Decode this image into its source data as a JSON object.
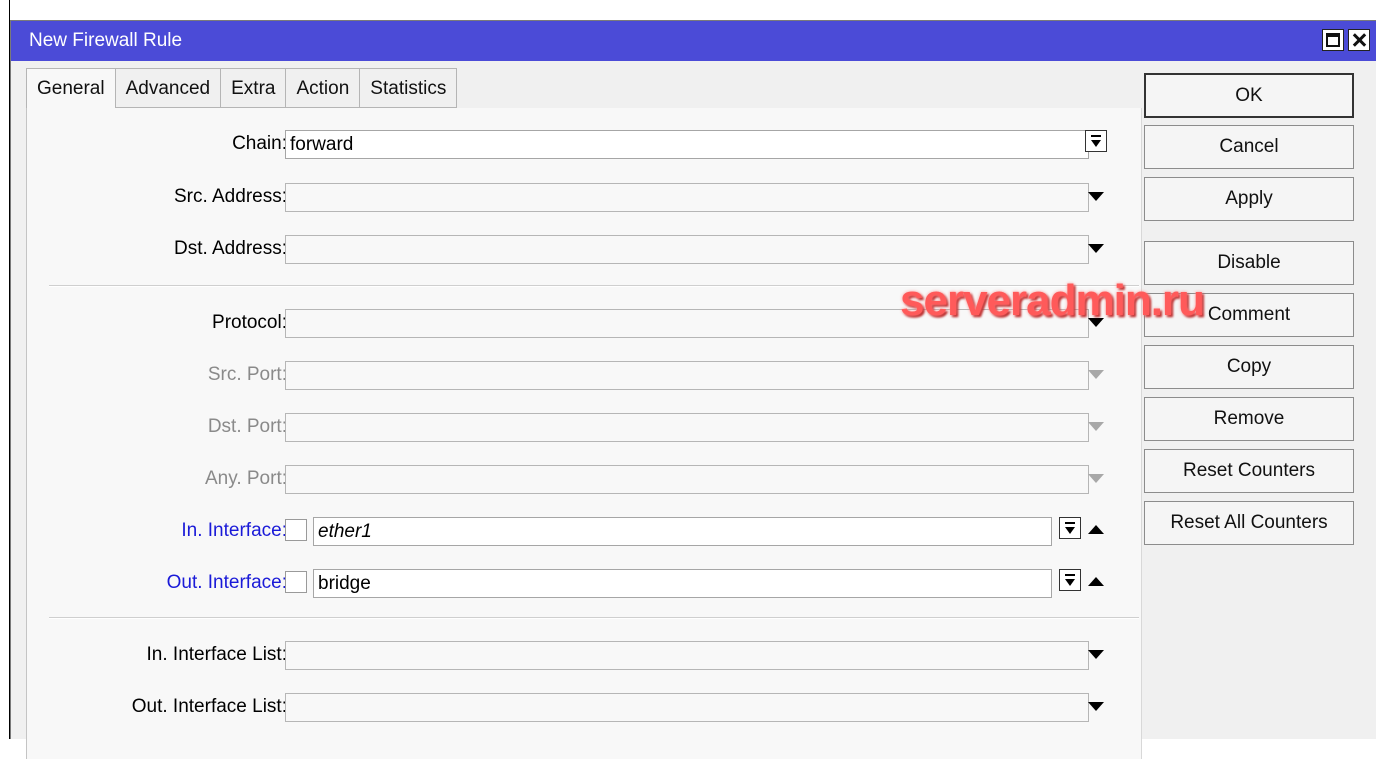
{
  "window": {
    "title": "New Firewall Rule"
  },
  "tabs": [
    "General",
    "Advanced",
    "Extra",
    "Action",
    "Statistics"
  ],
  "form": {
    "chain_label": "Chain:",
    "chain_value": "forward",
    "src_address_label": "Src. Address:",
    "src_address_value": "",
    "dst_address_label": "Dst. Address:",
    "dst_address_value": "",
    "protocol_label": "Protocol:",
    "protocol_value": "",
    "src_port_label": "Src. Port:",
    "dst_port_label": "Dst. Port:",
    "any_port_label": "Any. Port:",
    "in_interface_label": "In. Interface:",
    "in_interface_value": "ether1",
    "out_interface_label": "Out. Interface:",
    "out_interface_value": "bridge",
    "in_interface_list_label": "In. Interface List:",
    "in_interface_list_value": "",
    "out_interface_list_label": "Out. Interface List:",
    "out_interface_list_value": ""
  },
  "buttons": {
    "ok": "OK",
    "cancel": "Cancel",
    "apply": "Apply",
    "disable": "Disable",
    "comment": "Comment",
    "copy": "Copy",
    "remove": "Remove",
    "reset_counters": "Reset Counters",
    "reset_all_counters": "Reset All Counters"
  },
  "watermark": "serveradmin.ru",
  "colors": {
    "titlebar": "#4b4bd7",
    "link_label": "#1a1ad8",
    "watermark": "#ff5a5a"
  }
}
